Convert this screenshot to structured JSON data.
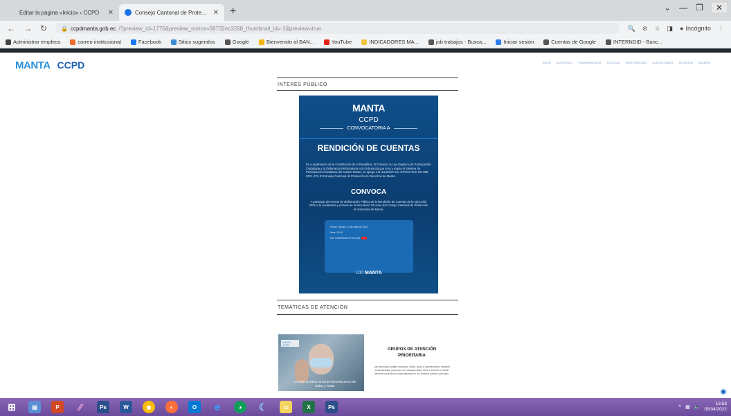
{
  "browser": {
    "tabs": [
      {
        "title": "Editar la página «Inicio» ‹ CCPD",
        "active": false
      },
      {
        "title": "Consejo Cantonal de Protección",
        "active": true
      }
    ],
    "new_tab_label": "+",
    "address": {
      "host": "ccpdmanta.gob.ec",
      "path": "/?preview_id=1776&preview_nonce=58732ec3268_thumbnail_id=-1&preview=true"
    },
    "incognito_label": "Incógnito",
    "bookmarks": [
      "Administrar empleos",
      "correo institucional",
      "Facebook",
      "Sitios sugeridos",
      "Google",
      "Bienvenido al BAN...",
      "YouTube",
      "INDICADORES MA...",
      "job trabajos - Busca...",
      "Iniciar sesión",
      "Cuentas de Google",
      "INTERNDID - Banc..."
    ]
  },
  "site": {
    "logo_manta": "MANTA",
    "logo_ccpd": "CCPD",
    "nav": [
      "INICIO",
      "NOSOTROS",
      "TRANSPARENCIA",
      "NOTICIAS",
      "PARTICIPACIÓN",
      "CONTÁCTANOS",
      "ATENCIÓN",
      "GALERÍA"
    ],
    "section1_title": "INTERES PÚBLICO",
    "poster": {
      "logo": "MANTA",
      "ccpd": "CCPD",
      "convocatoria": "CONVOCATORIA A",
      "headline": "RENDICIÓN DE CUENTAS",
      "body": "En cumplimiento de la Constitución de la República, El Consejo, la Ley Orgánica de Participación Ciudadana y la Ordenanza Reformatoria a la Ordenanza que crea y regula el Sistema de Participación Ciudadana del Cantón Manta, en apego a la resolución No. CPCCS-PLE-SG-069-2021-476, El Consejo Cantonal de Protección de Derechos de Manta.",
      "convoca": "CONVOCA",
      "body2": "A participar del evento de deliberación Pública de la Rendición de Cuentas de la ejecución 2021 a la ciudadanía y actores de la Secretaría Técnica del Consejo Cantonal de Protección de Derechos de Manta.",
      "card": {
        "fecha": "Fecha: Jueves, 21 de abril de 2022",
        "hora": "Hora: 15:00",
        "via": "Vía: Transmisión en vivo por"
      },
      "footer_brand": "MANTA",
      "footer_prefix": "100"
    },
    "section2_title": "TEMÁTICAS DE ATENCIÓN",
    "tematica": {
      "image_tag": "MANTA CCPD",
      "image_caption": "Consejo de Ética es RESPONSABILIDAD de Todos y Todas",
      "title": "GRUPOS DE ATENCIÓN PRIORITARIA",
      "description": "Las personas adultas mayores, niñas, niños y adolescentes, mujeres embarazadas, personas con discapacidad, tienen derecho a recibir atención prioritaria y especializada en los ámbitos público y privado."
    }
  },
  "taskbar": {
    "time": "16:58",
    "date": "05/04/2022"
  }
}
